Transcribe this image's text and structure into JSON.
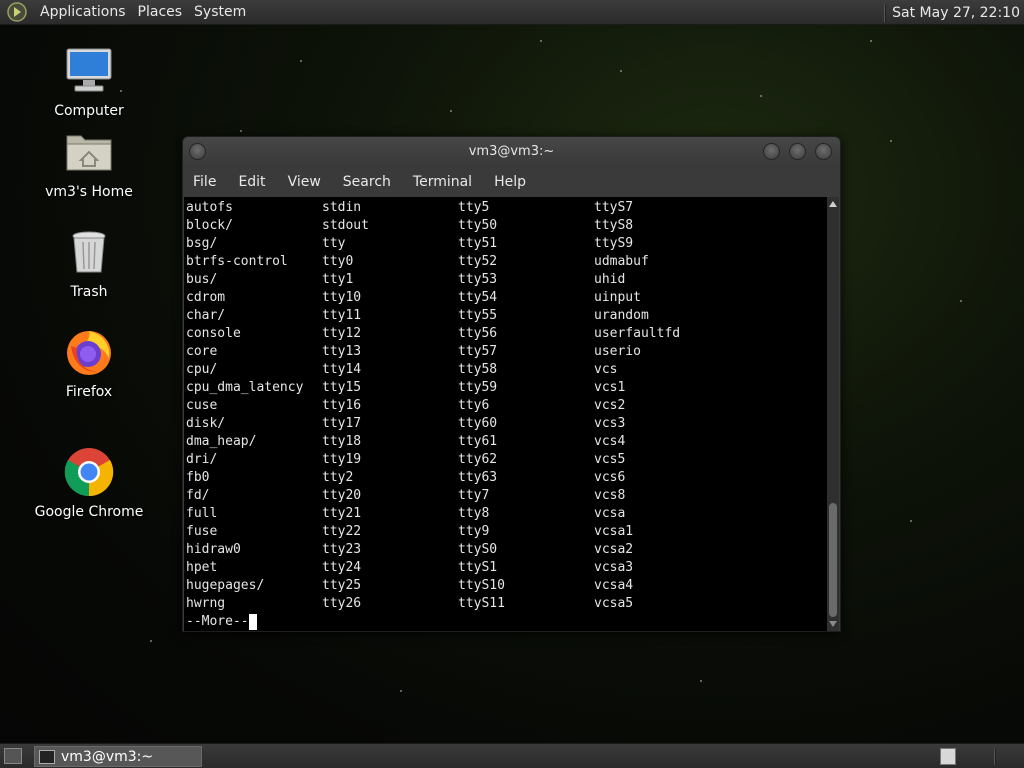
{
  "top_panel": {
    "menus": [
      "Applications",
      "Places",
      "System"
    ],
    "clock": "Sat May 27, 22:10"
  },
  "desktop_icons": [
    {
      "label": "Computer",
      "icon": "computer-icon"
    },
    {
      "label": "vm3's Home",
      "icon": "home-folder-icon"
    },
    {
      "label": "Trash",
      "icon": "trash-icon"
    },
    {
      "label": "Firefox",
      "icon": "firefox-icon"
    },
    {
      "label": "Google Chrome",
      "icon": "chrome-icon"
    }
  ],
  "terminal": {
    "title": "vm3@vm3:~",
    "menu": [
      "File",
      "Edit",
      "View",
      "Search",
      "Terminal",
      "Help"
    ],
    "rows": [
      [
        "autofs",
        "stdin",
        "tty5",
        "ttyS7"
      ],
      [
        "block/",
        "stdout",
        "tty50",
        "ttyS8"
      ],
      [
        "bsg/",
        "tty",
        "tty51",
        "ttyS9"
      ],
      [
        "btrfs-control",
        "tty0",
        "tty52",
        "udmabuf"
      ],
      [
        "bus/",
        "tty1",
        "tty53",
        "uhid"
      ],
      [
        "cdrom",
        "tty10",
        "tty54",
        "uinput"
      ],
      [
        "char/",
        "tty11",
        "tty55",
        "urandom"
      ],
      [
        "console",
        "tty12",
        "tty56",
        "userfaultfd"
      ],
      [
        "core",
        "tty13",
        "tty57",
        "userio"
      ],
      [
        "cpu/",
        "tty14",
        "tty58",
        "vcs"
      ],
      [
        "cpu_dma_latency",
        "tty15",
        "tty59",
        "vcs1"
      ],
      [
        "cuse",
        "tty16",
        "tty6",
        "vcs2"
      ],
      [
        "disk/",
        "tty17",
        "tty60",
        "vcs3"
      ],
      [
        "dma_heap/",
        "tty18",
        "tty61",
        "vcs4"
      ],
      [
        "dri/",
        "tty19",
        "tty62",
        "vcs5"
      ],
      [
        "fb0",
        "tty2",
        "tty63",
        "vcs6"
      ],
      [
        "fd/",
        "tty20",
        "tty7",
        "vcs8"
      ],
      [
        "full",
        "tty21",
        "tty8",
        "vcsa"
      ],
      [
        "fuse",
        "tty22",
        "tty9",
        "vcsa1"
      ],
      [
        "hidraw0",
        "tty23",
        "ttyS0",
        "vcsa2"
      ],
      [
        "hpet",
        "tty24",
        "ttyS1",
        "vcsa3"
      ],
      [
        "hugepages/",
        "tty25",
        "ttyS10",
        "vcsa4"
      ],
      [
        "hwrng",
        "tty26",
        "ttyS11",
        "vcsa5"
      ]
    ],
    "prompt": "--More--"
  },
  "taskbar": {
    "task_label": "vm3@vm3:~"
  }
}
